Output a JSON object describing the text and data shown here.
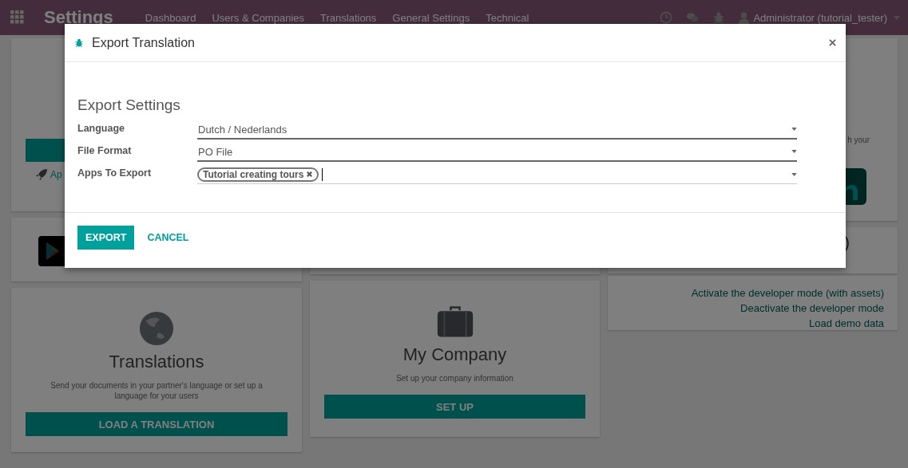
{
  "navbar": {
    "app_title": "Settings",
    "menu": [
      "Dashboard",
      "Users & Companies",
      "Translations",
      "General Settings",
      "Technical"
    ],
    "user": "Administrator (tutorial_tester)"
  },
  "background": {
    "apps_link": "Ap",
    "social_caption": "h your",
    "partial_text": ")",
    "developer_links": [
      "Activate the developer mode (with assets)",
      "Deactivate the developer mode",
      "Load demo data"
    ],
    "cards": [
      {
        "title": "Translations",
        "description": "Send your documents in your partner's language or set up a language for your users",
        "button": "LOAD A TRANSLATION",
        "kind": "globe"
      },
      {
        "title": "My Company",
        "description": "Set up your company information",
        "button": "SET UP",
        "kind": "briefcase"
      }
    ]
  },
  "dialog": {
    "title": "Export Translation",
    "section_title": "Export Settings",
    "fields": [
      {
        "label": "Language",
        "kind": "select",
        "value": "Dutch / Nederlands"
      },
      {
        "label": "File Format",
        "kind": "select",
        "value": "PO File"
      },
      {
        "label": "Apps To Export",
        "kind": "tags",
        "tags": [
          "Tutorial creating tours"
        ]
      }
    ],
    "buttons": [
      {
        "label": "EXPORT",
        "primary": true
      },
      {
        "label": "CANCEL",
        "primary": false
      }
    ]
  }
}
